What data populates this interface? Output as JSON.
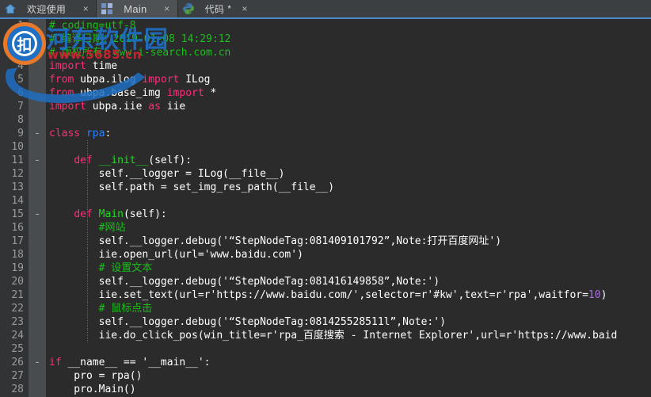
{
  "window": {
    "accent_color": "#4a88c7",
    "tabbar_bg": "#3c3f41",
    "editor_bg": "#2b2b2b",
    "gutter_bg": "#313335",
    "fold_bg": "#494c4e"
  },
  "tabs": [
    {
      "label": "欢迎使用",
      "icon": "home-icon",
      "active": false,
      "dirty": "",
      "close": "×"
    },
    {
      "label": "Main",
      "icon": "grid-icon",
      "active": true,
      "dirty": "",
      "close": "×"
    },
    {
      "label": "代码",
      "icon": "python-icon",
      "active": false,
      "dirty": "*",
      "close": "×"
    }
  ],
  "watermark": {
    "logo": "hedong-logo",
    "title": "河东软件园",
    "url": "www.5685.cn",
    "title_color": "#1f6fc4",
    "url_color": "#cf2233"
  },
  "editor": {
    "language": "Python",
    "first_line": 1,
    "lines": [
      {
        "n": 1,
        "fold": "",
        "guide": false,
        "tokens": [
          {
            "t": "# coding=utf-8",
            "c": "cmt"
          }
        ]
      },
      {
        "n": 2,
        "fold": "",
        "guide": false,
        "tokens": [
          {
            "t": "# 编译日期：2019-01-08 14:29:12",
            "c": "cmt"
          }
        ]
      },
      {
        "n": 3,
        "fold": "",
        "guide": false,
        "tokens": [
          {
            "t": "# 版权所有：www.i-search.com.cn",
            "c": "cmt"
          }
        ]
      },
      {
        "n": 4,
        "fold": "",
        "guide": false,
        "tokens": [
          {
            "t": "import",
            "c": "kw"
          },
          {
            "t": " time",
            "c": "pl"
          }
        ]
      },
      {
        "n": 5,
        "fold": "",
        "guide": false,
        "tokens": [
          {
            "t": "from",
            "c": "kw"
          },
          {
            "t": " ubpa.ilog ",
            "c": "pl"
          },
          {
            "t": "import",
            "c": "kw"
          },
          {
            "t": " ILog",
            "c": "pl"
          }
        ]
      },
      {
        "n": 6,
        "fold": "",
        "guide": false,
        "tokens": [
          {
            "t": "from",
            "c": "kw"
          },
          {
            "t": " ubpa.base_img ",
            "c": "pl"
          },
          {
            "t": "import",
            "c": "kw"
          },
          {
            "t": " *",
            "c": "pl"
          }
        ]
      },
      {
        "n": 7,
        "fold": "",
        "guide": false,
        "tokens": [
          {
            "t": "import",
            "c": "kw"
          },
          {
            "t": " ubpa.iie ",
            "c": "pl"
          },
          {
            "t": "as",
            "c": "kw"
          },
          {
            "t": " iie",
            "c": "pl"
          }
        ]
      },
      {
        "n": 8,
        "fold": "",
        "guide": false,
        "tokens": []
      },
      {
        "n": 9,
        "fold": "-",
        "guide": false,
        "tokens": [
          {
            "t": "class",
            "c": "kw"
          },
          {
            "t": " ",
            "c": "pl"
          },
          {
            "t": "rpa",
            "c": "cls"
          },
          {
            "t": ":",
            "c": "pl"
          }
        ]
      },
      {
        "n": 10,
        "fold": "",
        "guide": true,
        "tokens": []
      },
      {
        "n": 11,
        "fold": "-",
        "guide": true,
        "tokens": [
          {
            "t": "    ",
            "c": "pl"
          },
          {
            "t": "def",
            "c": "kw"
          },
          {
            "t": " ",
            "c": "pl"
          },
          {
            "t": "__init__",
            "c": "fn"
          },
          {
            "t": "(self):",
            "c": "pl"
          }
        ]
      },
      {
        "n": 12,
        "fold": "",
        "guide": true,
        "tokens": [
          {
            "t": "        self.__logger = ILog(__file__)",
            "c": "pl"
          }
        ]
      },
      {
        "n": 13,
        "fold": "",
        "guide": true,
        "tokens": [
          {
            "t": "        self.path = set_img_res_path(__file__)",
            "c": "pl"
          }
        ]
      },
      {
        "n": 14,
        "fold": "",
        "guide": true,
        "tokens": []
      },
      {
        "n": 15,
        "fold": "-",
        "guide": true,
        "tokens": [
          {
            "t": "    ",
            "c": "pl"
          },
          {
            "t": "def",
            "c": "kw"
          },
          {
            "t": " ",
            "c": "pl"
          },
          {
            "t": "Main",
            "c": "fn"
          },
          {
            "t": "(self):",
            "c": "pl"
          }
        ]
      },
      {
        "n": 16,
        "fold": "",
        "guide": true,
        "tokens": [
          {
            "t": "        ",
            "c": "pl"
          },
          {
            "t": "#网站",
            "c": "cmt"
          }
        ]
      },
      {
        "n": 17,
        "fold": "",
        "guide": true,
        "tokens": [
          {
            "t": "        self.__logger.debug('“StepNodeTag:081409101792”,Note:打开百度网址')",
            "c": "pl"
          }
        ]
      },
      {
        "n": 18,
        "fold": "",
        "guide": true,
        "tokens": [
          {
            "t": "        iie.open_url(url='www.baidu.com')",
            "c": "pl"
          }
        ]
      },
      {
        "n": 19,
        "fold": "",
        "guide": true,
        "tokens": [
          {
            "t": "        ",
            "c": "pl"
          },
          {
            "t": "# 设置文本",
            "c": "cmt"
          }
        ]
      },
      {
        "n": 20,
        "fold": "",
        "guide": true,
        "tokens": [
          {
            "t": "        self.__logger.debug('“StepNodeTag:081416149858”,Note:')",
            "c": "pl"
          }
        ]
      },
      {
        "n": 21,
        "fold": "",
        "guide": true,
        "tokens": [
          {
            "t": "        iie.set_text(url=r'https://www.baidu.com/',selector=r'#kw',text=r'rpa',waitfor=",
            "c": "pl"
          },
          {
            "t": "10",
            "c": "num"
          },
          {
            "t": ")",
            "c": "pl"
          }
        ]
      },
      {
        "n": 22,
        "fold": "",
        "guide": true,
        "tokens": [
          {
            "t": "        ",
            "c": "pl"
          },
          {
            "t": "# 鼠标点击",
            "c": "cmt"
          }
        ]
      },
      {
        "n": 23,
        "fold": "",
        "guide": true,
        "tokens": [
          {
            "t": "        self.__logger.debug('“StepNodeTag:081425528511l”,Note:')",
            "c": "pl"
          }
        ]
      },
      {
        "n": 24,
        "fold": "",
        "guide": true,
        "tokens": [
          {
            "t": "        iie.do_click_pos(win_title=r'rpa_百度搜索 - Internet Explorer',url=r'https://www.baid",
            "c": "pl"
          }
        ]
      },
      {
        "n": 25,
        "fold": "",
        "guide": false,
        "tokens": []
      },
      {
        "n": 26,
        "fold": "-",
        "guide": false,
        "tokens": [
          {
            "t": "if",
            "c": "kw"
          },
          {
            "t": " __name__ == '__main__':",
            "c": "pl"
          }
        ]
      },
      {
        "n": 27,
        "fold": "",
        "guide": false,
        "tokens": [
          {
            "t": "    pro = rpa()",
            "c": "pl"
          }
        ]
      },
      {
        "n": 28,
        "fold": "",
        "guide": false,
        "tokens": [
          {
            "t": "    pro.Main()",
            "c": "pl"
          }
        ]
      }
    ]
  }
}
